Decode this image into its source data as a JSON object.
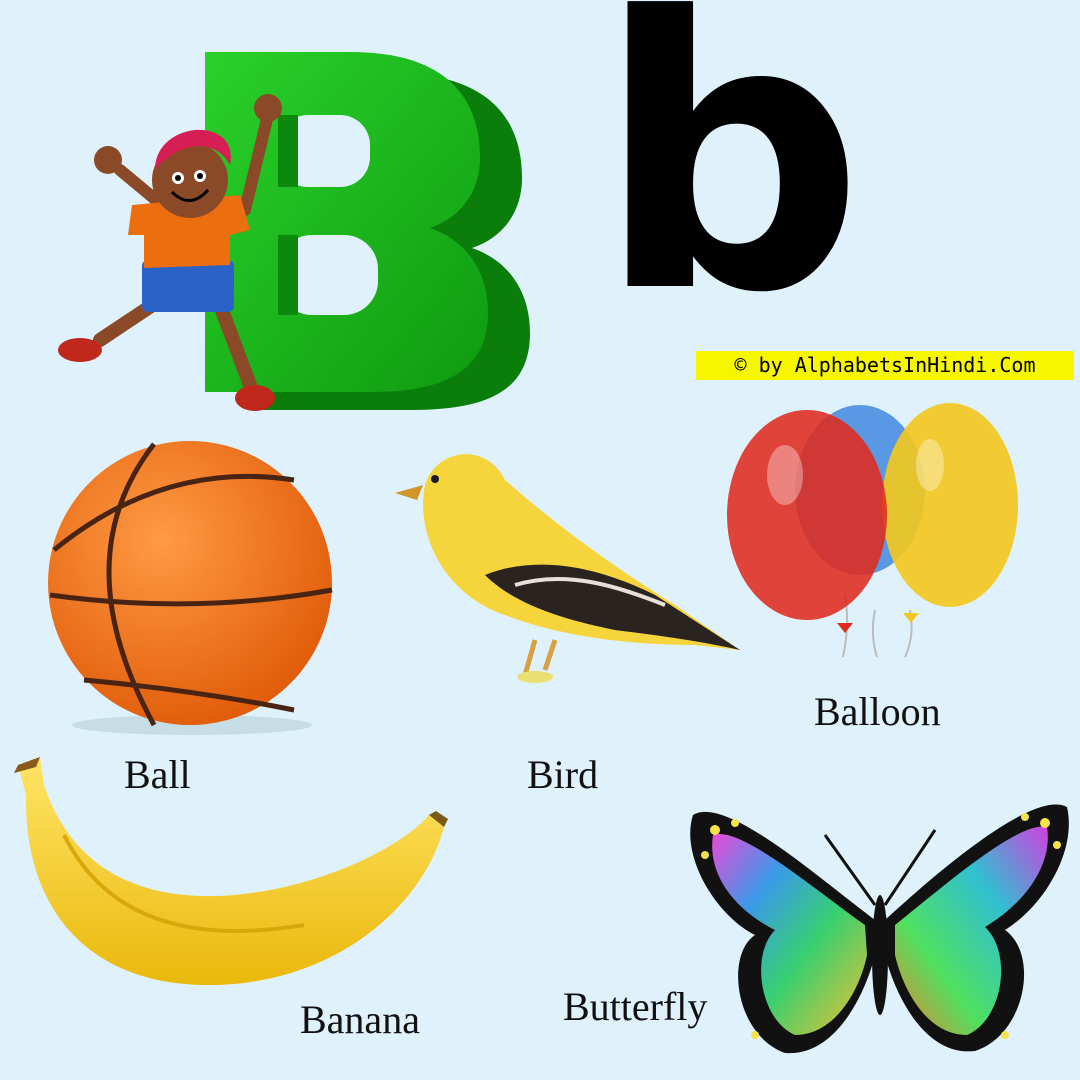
{
  "letters": {
    "upper": "B",
    "lower": "b"
  },
  "copyright": "© by AlphabetsInHindi.Com",
  "items": [
    {
      "label": "Ball",
      "icon": "basketball-icon"
    },
    {
      "label": "Bird",
      "icon": "yellow-bird-icon"
    },
    {
      "label": "Balloon",
      "icon": "balloons-icon"
    },
    {
      "label": "Banana",
      "icon": "banana-icon"
    },
    {
      "label": "Butterfly",
      "icon": "butterfly-icon"
    }
  ],
  "colors": {
    "background": "#dff2fb",
    "letter_b_green": "#14b814",
    "copyright_bg": "#f6f600",
    "ball": "#f07018",
    "bird": "#f5d33a",
    "banana": "#f6d018"
  }
}
